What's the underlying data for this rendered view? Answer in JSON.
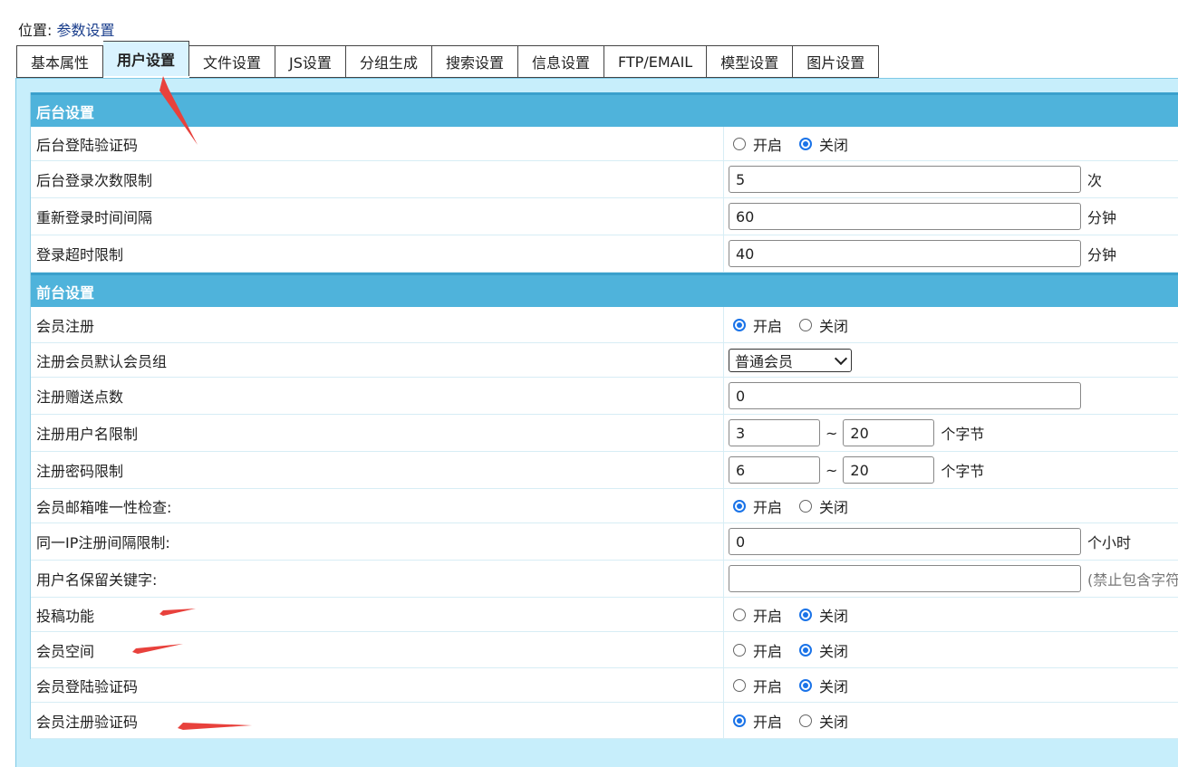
{
  "breadcrumb": {
    "prefix": "位置:",
    "current": "参数设置"
  },
  "tabs": [
    {
      "label": "基本属性",
      "active": false
    },
    {
      "label": "用户设置",
      "active": true
    },
    {
      "label": "文件设置",
      "active": false
    },
    {
      "label": "JS设置",
      "active": false
    },
    {
      "label": "分组生成",
      "active": false
    },
    {
      "label": "搜索设置",
      "active": false
    },
    {
      "label": "信息设置",
      "active": false
    },
    {
      "label": "FTP/EMAIL",
      "active": false
    },
    {
      "label": "模型设置",
      "active": false
    },
    {
      "label": "图片设置",
      "active": false
    }
  ],
  "backend": {
    "title": "后台设置",
    "login_captcha": {
      "label": "后台登陆验证码",
      "on": "开启",
      "off": "关闭",
      "selected": "off"
    },
    "login_limit": {
      "label": "后台登录次数限制",
      "value": "5",
      "unit": "次"
    },
    "relogin_interval": {
      "label": "重新登录时间间隔",
      "value": "60",
      "unit": "分钟"
    },
    "login_timeout": {
      "label": "登录超时限制",
      "value": "40",
      "unit": "分钟"
    }
  },
  "frontend": {
    "title": "前台设置",
    "member_register": {
      "label": "会员注册",
      "on": "开启",
      "off": "关闭",
      "selected": "on"
    },
    "default_group": {
      "label": "注册会员默认会员组",
      "value": "普通会员"
    },
    "bonus_points": {
      "label": "注册赠送点数",
      "value": "0"
    },
    "username_limit": {
      "label": "注册用户名限制",
      "min": "3",
      "tilde": "~",
      "max": "20",
      "unit": "个字节"
    },
    "password_limit": {
      "label": "注册密码限制",
      "min": "6",
      "tilde": "~",
      "max": "20",
      "unit": "个字节"
    },
    "email_unique": {
      "label": "会员邮箱唯一性检查:",
      "on": "开启",
      "off": "关闭",
      "selected": "on"
    },
    "ip_interval": {
      "label": "同一IP注册间隔限制:",
      "value": "0",
      "unit": "个小时"
    },
    "reserved_keywords": {
      "label": "用户名保留关键字:",
      "value": "",
      "hint": "(禁止包含字符"
    },
    "contribute": {
      "label": "投稿功能",
      "on": "开启",
      "off": "关闭",
      "selected": "off"
    },
    "member_space": {
      "label": "会员空间",
      "on": "开启",
      "off": "关闭",
      "selected": "off"
    },
    "member_login_captcha": {
      "label": "会员登陆验证码",
      "on": "开启",
      "off": "关闭",
      "selected": "off"
    },
    "member_register_captcha": {
      "label": "会员注册验证码",
      "on": "开启",
      "off": "关闭",
      "selected": "on"
    }
  },
  "colors": {
    "header": "#4fb3db",
    "panel": "#c7eefb",
    "annotation": "#e8413c",
    "radio": "#1a73e8"
  }
}
